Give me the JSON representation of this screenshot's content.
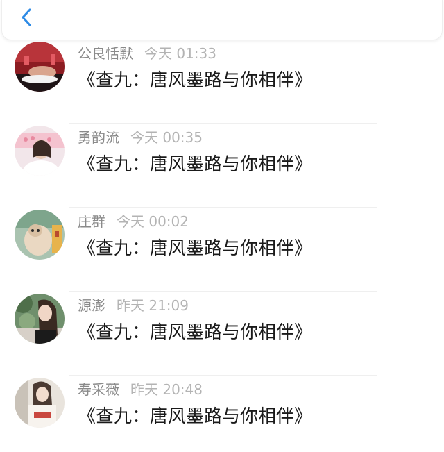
{
  "header": {
    "back_icon": "chevron-left-icon",
    "accent_color": "#2e8be6"
  },
  "messages": [
    {
      "name": "公良恬默",
      "time": "今天 01:33",
      "text": "《查九：唐风墨路与你相伴》",
      "avatar": "avatar-red-wine"
    },
    {
      "name": "勇韵流",
      "time": "今天 00:35",
      "text": "《查九：唐风墨路与你相伴》",
      "avatar": "avatar-pink-girl"
    },
    {
      "name": "庄群",
      "time": "今天 00:02",
      "text": "《查九：唐风墨路与你相伴》",
      "avatar": "avatar-cat"
    },
    {
      "name": "源澎",
      "time": "昨天 21:09",
      "text": "《查九：唐风墨路与你相伴》",
      "avatar": "avatar-girl-trees"
    },
    {
      "name": "寿采薇",
      "time": "昨天 20:48",
      "text": "《查九：唐风墨路与你相伴》",
      "avatar": "avatar-girl-shirt"
    }
  ]
}
